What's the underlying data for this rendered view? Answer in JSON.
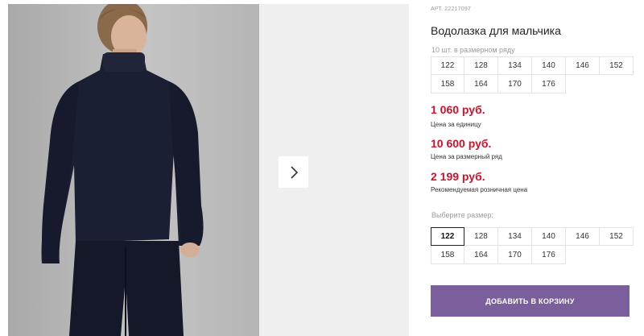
{
  "product": {
    "sku_label": "АРТ.",
    "sku_value": "22217097",
    "title": "Водолазка для мальчика",
    "pack_note": "10 шт. в размерном ряду"
  },
  "pack_sizes": [
    "122",
    "128",
    "134",
    "140",
    "146",
    "152",
    "158",
    "164",
    "170",
    "176"
  ],
  "prices": {
    "unit_price": "1 060 руб.",
    "unit_note": "Цена за единицу",
    "pack_price": "10 600 руб.",
    "pack_note": "Цена за размерный ряд",
    "retail_price": "2 199 руб.",
    "retail_note": "Рекомендуемая розничная цена"
  },
  "size_picker": {
    "label": "Выберите размер:",
    "sizes": [
      "122",
      "128",
      "134",
      "140",
      "146",
      "152",
      "158",
      "164",
      "170",
      "176"
    ],
    "selected": "122"
  },
  "cart": {
    "add_label": "ДОБАВИТЬ В КОРЗИНУ"
  },
  "gallery": {
    "next_icon": "chevron-right-icon"
  },
  "colors": {
    "price": "#d0112b",
    "button": "#7b5f9d",
    "garment": "#1b1f33"
  }
}
